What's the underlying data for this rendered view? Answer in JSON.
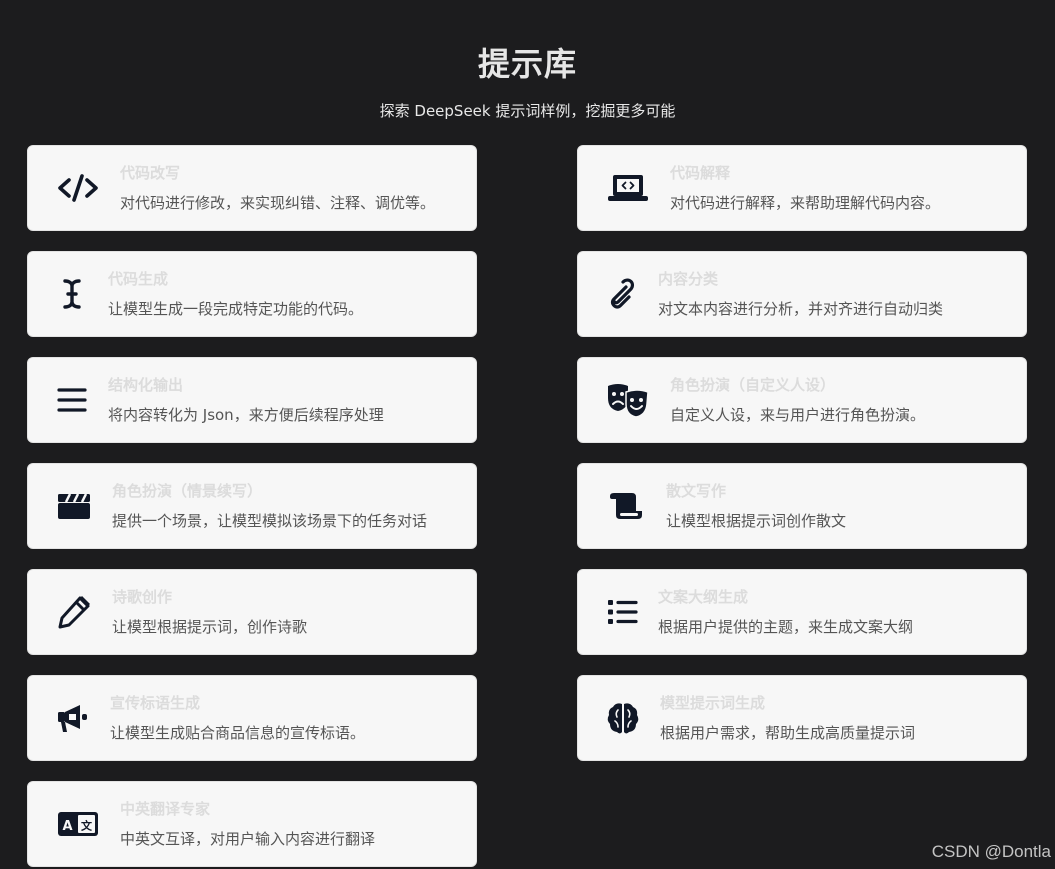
{
  "page": {
    "title": "提示库",
    "subtitle": "探索 DeepSeek 提示词样例，挖掘更多可能"
  },
  "colors": {
    "background": "#1c1c1e",
    "card_background": "#f7f7f7",
    "icon": "#111827",
    "card_title": "#dcdcdc",
    "card_description": "#555555"
  },
  "cards": [
    {
      "icon": "code-icon",
      "title": "代码改写",
      "description": "对代码进行修改，来实现纠错、注释、调优等。"
    },
    {
      "icon": "laptop-code-icon",
      "title": "代码解释",
      "description": "对代码进行解释，来帮助理解代码内容。"
    },
    {
      "icon": "text-cursor-icon",
      "title": "代码生成",
      "description": "让模型生成一段完成特定功能的代码。"
    },
    {
      "icon": "paperclip-icon",
      "title": "内容分类",
      "description": "对文本内容进行分析，并对齐进行自动归类"
    },
    {
      "icon": "bars-icon",
      "title": "结构化输出",
      "description": "将内容转化为 Json，来方便后续程序处理"
    },
    {
      "icon": "masks-theater-icon",
      "title": "角色扮演（自定义人设）",
      "description": "自定义人设，来与用户进行角色扮演。"
    },
    {
      "icon": "clapperboard-icon",
      "title": "角色扮演（情景续写）",
      "description": "提供一个场景，让模型模拟该场景下的任务对话"
    },
    {
      "icon": "scroll-icon",
      "title": "散文写作",
      "description": "让模型根据提示词创作散文"
    },
    {
      "icon": "pencil-icon",
      "title": "诗歌创作",
      "description": "让模型根据提示词，创作诗歌"
    },
    {
      "icon": "list-icon",
      "title": "文案大纲生成",
      "description": "根据用户提供的主题，来生成文案大纲"
    },
    {
      "icon": "bullhorn-icon",
      "title": "宣传标语生成",
      "description": "让模型生成贴合商品信息的宣传标语。"
    },
    {
      "icon": "brain-icon",
      "title": "模型提示词生成",
      "description": "根据用户需求，帮助生成高质量提示词"
    },
    {
      "icon": "language-icon",
      "title": "中英翻译专家",
      "description": "中英文互译，对用户输入内容进行翻译"
    }
  ],
  "watermark": "CSDN @Dontla"
}
